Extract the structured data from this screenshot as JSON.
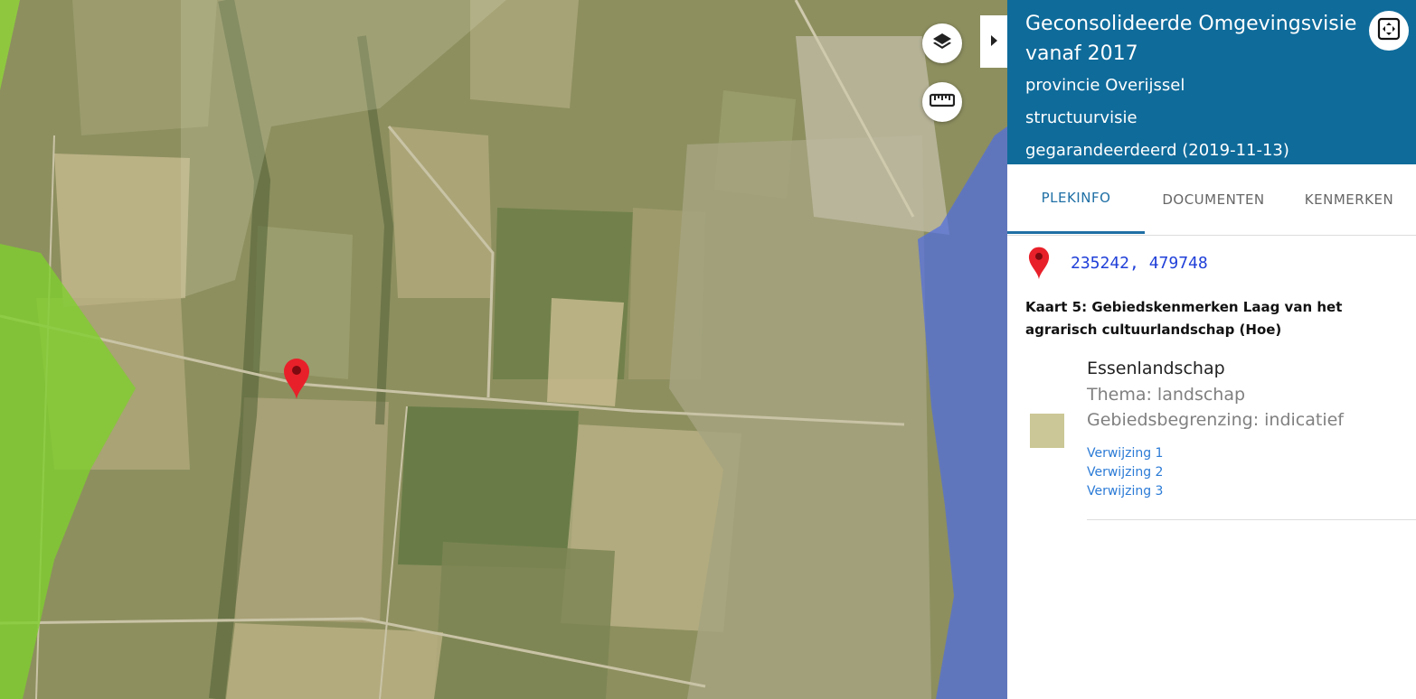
{
  "map": {
    "layers_button_icon": "layers-icon",
    "measure_button_icon": "ruler-icon",
    "marker_icon": "map-pin-icon",
    "toggle_icon": "caret-right-icon"
  },
  "panel": {
    "title": "Geconsolideerde Omgevingsvisie vanaf 2017",
    "organisation": "provincie Overijssel",
    "plan_type": "structuurvisie",
    "status": "gegarandeerdeerd (2019-11-13)",
    "fullscreen_icon": "fullscreen-icon",
    "header_color": "#0f6b9a",
    "tabs": [
      {
        "label": "PLEKINFO",
        "active": true
      },
      {
        "label": "DOCUMENTEN",
        "active": false
      },
      {
        "label": "KENMERKEN",
        "active": false
      }
    ],
    "location": {
      "icon": "map-pin-icon",
      "coordinates": "235242, 479748"
    },
    "kaart_title": "Kaart 5: Gebiedskenmerken Laag van het agrarisch cultuurlandschap (Hoe)",
    "feature": {
      "name": "Essenlandschap",
      "thema": "Thema: landschap",
      "begrenzing": "Gebiedsbegrenzing: indicatief",
      "swatch_color": "#cbc796",
      "references": [
        "Verwijzing 1",
        "Verwijzing 2",
        "Verwijzing 3"
      ]
    }
  }
}
